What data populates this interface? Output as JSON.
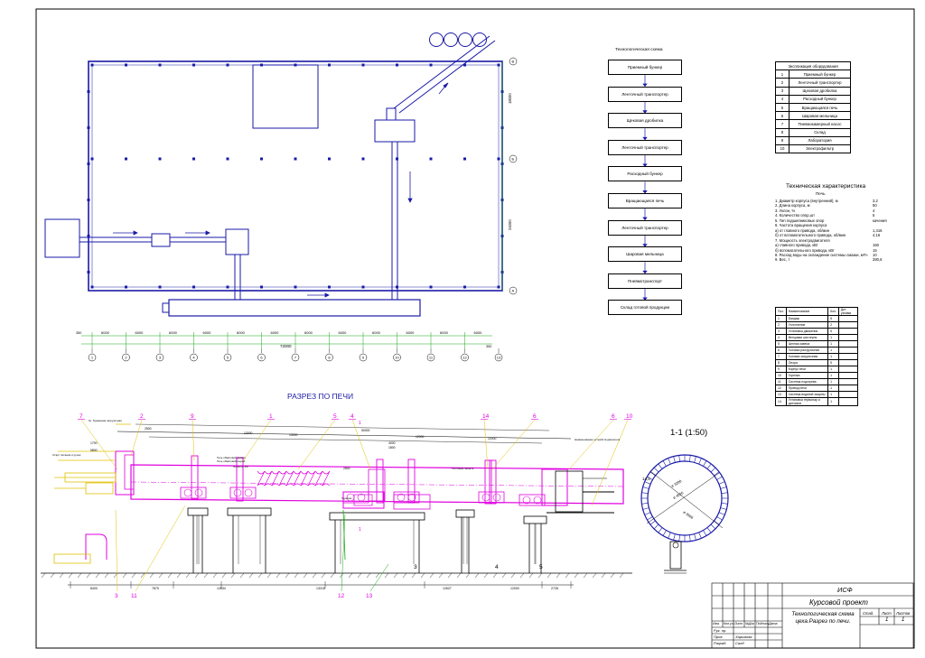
{
  "plan": {
    "dims": [
      "6000",
      "6000",
      "6000",
      "6000",
      "6000",
      "6000",
      "6000",
      "6000",
      "6000",
      "6000",
      "6000",
      "6000"
    ],
    "total_dim": "72000",
    "edge_dims": [
      "350",
      "350"
    ],
    "axes": [
      "1",
      "2",
      "3",
      "4",
      "5",
      "6",
      "7",
      "8",
      "9",
      "10",
      "11",
      "12",
      "13"
    ],
    "row_axes": [
      "В",
      "Б",
      "А"
    ],
    "row_dims": [
      "18000",
      "24000"
    ]
  },
  "flow": {
    "title": "Технологическая схема",
    "steps": [
      "Приемный бункер",
      "Ленточный транспортер",
      "Щековая дробилка",
      "Ленточный транспортер",
      "Расходный бункер",
      "Вращающаяся печь",
      "Ленточный транспортер",
      "Шаровая мельница",
      "Пневмотранспорт",
      "Склад готовой продукции"
    ]
  },
  "equipment": {
    "title": "Экспликация оборудования",
    "rows": [
      [
        "1",
        "Приемный бункер"
      ],
      [
        "2",
        "Ленточный транспортер"
      ],
      [
        "3",
        "Щековая дробилка"
      ],
      [
        "4",
        "Расходный бункер"
      ],
      [
        "5",
        "Вращающаяся печь"
      ],
      [
        "6",
        "Шаровая мельница"
      ],
      [
        "7",
        "Пневмокамерный насос"
      ],
      [
        "8",
        "Склад"
      ],
      [
        "9",
        "Лаборатория"
      ],
      [
        "10",
        "Электрофильтр"
      ]
    ]
  },
  "specs": {
    "title": "Техническая характеристика",
    "subtitle": "Печь",
    "rows": [
      [
        "1. Диаметр корпуса (внутренний), м",
        "3,2"
      ],
      [
        "2. Длина корпуса, м",
        "50"
      ],
      [
        "3. Уклон, %",
        "4"
      ],
      [
        "4. Количество опор,шт",
        "5"
      ],
      [
        "5. Тип подшипниковых опор",
        "качения"
      ],
      [
        "6. Частота вращения корпуса",
        ""
      ],
      [
        "а) от главного привода, об/мин",
        "1,416"
      ],
      [
        "б) от вспомогательного привода, об/мин",
        "4,16"
      ],
      [
        "7. Мощность электродвигателя",
        ""
      ],
      [
        "а) главного привода, кВт",
        "160"
      ],
      [
        "б) вспомогательного привода, кВт",
        "15"
      ],
      [
        "8. Расход воды на охлаждение системы смазки, м³/ч",
        "10"
      ],
      [
        "9. Вес, т",
        "280,6"
      ]
    ]
  },
  "parts": {
    "headers": [
      "Поз.",
      "Наименование",
      "Кол.",
      "Дет. узлами"
    ],
    "rows": [
      [
        "1",
        "Бандаж",
        "5"
      ],
      [
        "2",
        "Уплотнение",
        "2"
      ],
      [
        "3",
        "Установка движения",
        "5"
      ],
      [
        "4",
        "Венцовая шестерня",
        "1"
      ],
      [
        "5",
        "Цепная завеса",
        "1"
      ],
      [
        "6",
        "Головка разгрузочная",
        "1"
      ],
      [
        "7",
        "Головка загрузочная",
        "1"
      ],
      [
        "8",
        "Опора",
        "5"
      ],
      [
        "9",
        "Корпус печи",
        "1"
      ],
      [
        "10",
        "Горелка",
        "1"
      ],
      [
        "11",
        "Система подогрева",
        "1"
      ],
      [
        "12",
        "Привод печи",
        "1"
      ],
      [
        "13",
        "Система водяной защиты",
        "1"
      ],
      [
        "14",
        "Установка термопар и датчиков",
        "1"
      ]
    ]
  },
  "section": {
    "title": "РАЗРЕЗ ПО ПЕЧИ",
    "callouts_top": [
      "7",
      "2",
      "9",
      "1",
      "5",
      "4",
      "14",
      "6",
      "6",
      "10"
    ],
    "callouts_bottom": [
      "3",
      "11",
      "12",
      "13",
      "3",
      "4",
      "5"
    ],
    "notes": [
      "Гр. бункерная загрузочная",
      "Старт питания и ручек",
      "Течь обжиговой дымки",
      "Течь обжиговой сырой",
      "Горелка",
      "Полость 4%",
      "Тепловая защита",
      "Наименование устройств двигателя"
    ],
    "top_dims": [
      "50000",
      "13000",
      "13000",
      "12000",
      "12000",
      "4000",
      "1800",
      "2500",
      "2800",
      "1700",
      "5800"
    ],
    "bottom_dims": [
      "8400",
      "7875",
      "12634",
      "13218",
      "12627",
      "12000",
      "2728"
    ],
    "section_mark": "1"
  },
  "cross_section": {
    "title": "1-1  (1:50)",
    "dims": [
      "ø 3200",
      "ø 4026",
      "ø 3666",
      "14,5"
    ]
  },
  "title_block": {
    "org": "ИСФ",
    "project": "Курсовой проект",
    "description": "Технологическая схема цеха.Разрез по печи.",
    "col_stage": "Стад.",
    "col_sheet": "Лист",
    "col_sheets": "Листов",
    "sheet": "1",
    "sheets": "1",
    "headers": [
      "Изм.",
      "Кол.уч",
      "Лист",
      "№Док",
      "Подпись",
      "Дата"
    ],
    "roles": [
      "Рук. пр.",
      "Пров.",
      "Разраб."
    ],
    "names": [
      "",
      "Харьмова",
      "Салд"
    ]
  }
}
